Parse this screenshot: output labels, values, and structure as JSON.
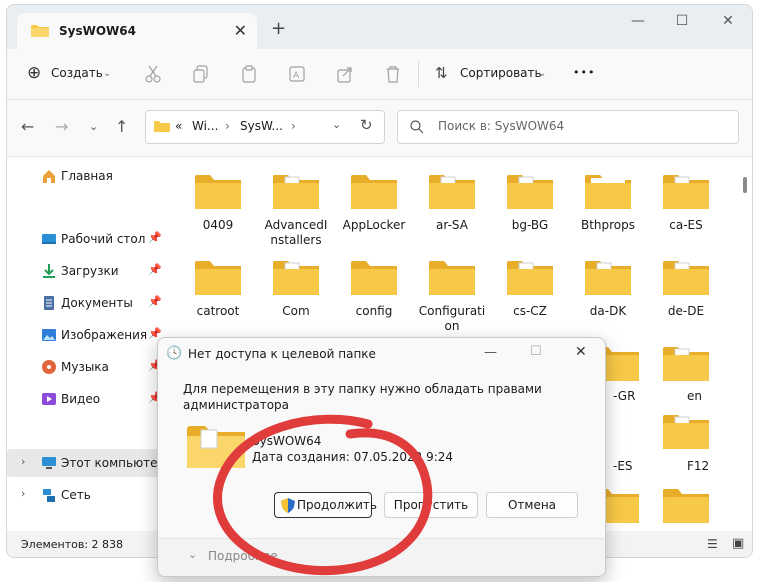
{
  "tab": {
    "title": "SysWOW64",
    "close": "✕",
    "new": "+"
  },
  "window_controls": {
    "minimize": "—",
    "maximize": "☐",
    "close": "✕"
  },
  "toolbar": {
    "create_label": "Создать",
    "sort_label": "Сортировать",
    "more": "•••"
  },
  "address": {
    "crumbs": [
      "«",
      "Wi...",
      "›",
      "SysW...",
      "›"
    ],
    "placeholder": "Поиск в: SysWOW64"
  },
  "sidebar": {
    "items": [
      {
        "label": "Главная",
        "icon": "home-icon"
      },
      {
        "label": "Рабочий стол",
        "icon": "desktop-icon",
        "pinned": true
      },
      {
        "label": "Загрузки",
        "icon": "download-icon",
        "pinned": true
      },
      {
        "label": "Документы",
        "icon": "documents-icon",
        "pinned": true
      },
      {
        "label": "Изображения",
        "icon": "images-icon",
        "pinned": true
      },
      {
        "label": "Музыка",
        "icon": "music-icon",
        "pinned": true
      },
      {
        "label": "Видео",
        "icon": "video-icon",
        "pinned": true
      },
      {
        "label": "Этот компьютер",
        "icon": "computer-icon",
        "expandable": true,
        "selected": true
      },
      {
        "label": "Сеть",
        "icon": "network-icon",
        "expandable": true
      }
    ]
  },
  "folders": {
    "row1": [
      "0409",
      "AdvancedI nstallers",
      "AppLocker",
      "ar-SA",
      "bg-BG",
      "Bthprops",
      "ca-ES"
    ],
    "row2": [
      "catroot",
      "Com",
      "config",
      "Configurati on",
      "cs-CZ",
      "da-DK",
      "de-DE"
    ],
    "right_col": [
      "-GR",
      "en",
      "-ES",
      "F12"
    ]
  },
  "status": {
    "count": "Элементов: 2 838"
  },
  "dialog": {
    "title": "Нет доступа к целевой папке",
    "message": "Для перемещения в эту папку нужно обладать правами администратора",
    "folder_name": "SysWOW64",
    "folder_date": "Дата создания: 07.05.2022 9:24",
    "continue": "Продолжить",
    "skip": "Пропустить",
    "cancel": "Отмена",
    "details": "Подробнее",
    "minimize": "—",
    "maximize": "☐",
    "close": "✕"
  },
  "colors": {
    "folder": "#f7c948",
    "folder_dark": "#e8ae2a",
    "annotation": "#e03c3c",
    "accent": "#0067c0"
  }
}
